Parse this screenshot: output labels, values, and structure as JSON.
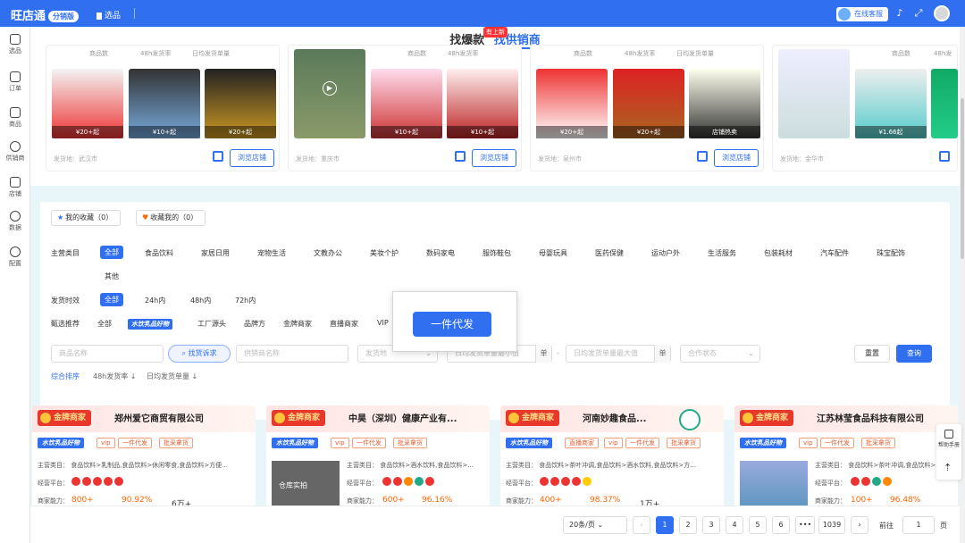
{
  "app": {
    "logo": "旺店通",
    "version": "分销版",
    "nav_item": "选品",
    "service_label": "在线客服"
  },
  "sidebar": [
    {
      "label": "选品"
    },
    {
      "label": "订单"
    },
    {
      "label": "商品"
    },
    {
      "label": "供销商"
    },
    {
      "label": "店铺"
    },
    {
      "label": "数据"
    },
    {
      "label": "配置"
    }
  ],
  "upper": {
    "tab_hot": "找爆款",
    "tab_supplier": "找供销商",
    "hot_badge": "有上新",
    "cards": [
      {
        "hdr": [
          "商品数",
          "48h发货率",
          "日均发货单量"
        ],
        "prices": [
          "¥20+起",
          "¥10+起",
          "¥20+起"
        ],
        "loc": "发货地：武汉市",
        "browse": "浏览店铺"
      },
      {
        "hdr": [
          "商品数",
          "48h发货率"
        ],
        "prices": [
          "",
          "¥10+起",
          "¥10+起"
        ],
        "loc": "发货地：重庆市",
        "browse": "浏览店铺"
      },
      {
        "hdr": [
          "商品数",
          "48h发货率",
          "日均发货单量"
        ],
        "prices": [
          "¥20+起",
          "¥20+起",
          "店铺热卖"
        ],
        "loc": "发货地：泉州市",
        "browse": "浏览店铺"
      },
      {
        "hdr": [
          "商品数",
          "48h发"
        ],
        "prices": [
          "",
          "¥1.66起",
          ""
        ],
        "loc": "发货地：金华市",
        "browse": ""
      }
    ]
  },
  "filter": {
    "my_fav": "我的收藏（0）",
    "fav_me": "收藏我的（0）",
    "cat_label": "主营类目",
    "categories": [
      "全部",
      "食品饮料",
      "家居日用",
      "宠物生活",
      "文教办公",
      "美妆个护",
      "数码家电",
      "服饰鞋包",
      "母婴玩具",
      "医药保健",
      "运动户外",
      "生活服务",
      "包装耗材",
      "汽车配件",
      "珠宝配饰",
      "其他"
    ],
    "ship_label": "发货时效",
    "ship_options": [
      "全部",
      "24h内",
      "48h内",
      "72h内"
    ],
    "rec_label": "甄选推荐",
    "rec_options": [
      "全部",
      "水饮乳品好物",
      "工厂源头",
      "品牌方",
      "金牌商家",
      "直播商家",
      "VIP"
    ],
    "inputs": {
      "product_name": "商品名称",
      "find_btn": "找货诉求",
      "supplier_name": "供销商名称",
      "ship_place": "发货地",
      "daily_min": "日均发货单量最小值",
      "daily_max": "日均发货单量最大值",
      "unit": "单",
      "coop_status": "合作状态"
    },
    "reset": "重置",
    "query": "查询",
    "sort": [
      "综合排序",
      "48h发货率",
      "日均发货单量"
    ],
    "popup_btn": "一件代发"
  },
  "suppliers": [
    {
      "badge": "金牌商家",
      "name": "郑州爱它商贸有限公司",
      "chips": [
        "水饮乳品好物",
        "vip",
        "一件代发",
        "批采拿货"
      ],
      "category": "主营类目：  食品饮料>乳制品,食品饮料>休闲零食,食品饮料>方便...",
      "platform": "经营平台：",
      "ability": "商家能力：",
      "v1": "800+",
      "v2": "90.92%",
      "v3": "6万+"
    },
    {
      "badge": "金牌商家",
      "name": "中昊（深圳）健康产业有...",
      "chips": [
        "水饮乳品好物",
        "vip",
        "一件代发",
        "批采拿货"
      ],
      "category": "主营类目：  食品饮料>酒水饮料,食品饮料>...",
      "platform": "经营平台：",
      "ability": "商家能力：",
      "v1": "600+",
      "v2": "96.16%",
      "v3": "",
      "thumb_text": "仓库实拍"
    },
    {
      "badge": "金牌商家",
      "name": "河南妙趣食品...",
      "chips": [
        "水饮乳品好物",
        "直播商家",
        "vip",
        "一件代发",
        "批采拿货"
      ],
      "category": "主营类目：  食品饮料>茶叶冲调,食品饮料>酒水饮料,食品饮料>方...",
      "platform": "经营平台：",
      "ability": "商家能力：",
      "v1": "400+",
      "v2": "98.37%",
      "v3": "1万+"
    },
    {
      "badge": "金牌商家",
      "name": "江苏林莹食品科技有限公司",
      "chips": [
        "水饮乳品好物",
        "vip",
        "一件代发",
        "批采拿货"
      ],
      "category": "主营类目：  食品饮料>茶叶冲调,食品饮料>...",
      "platform": "经营平台：",
      "ability": "商家能力：",
      "v1": "100+",
      "v2": "96.48%",
      "v3": ""
    }
  ],
  "pager": {
    "page_size": "20条/页",
    "pages": [
      "1",
      "2",
      "3",
      "4",
      "5",
      "6",
      "•••",
      "1039"
    ],
    "goto": "前往",
    "goto_value": "1",
    "page_unit": "页"
  },
  "help": {
    "label": "帮助手册"
  }
}
